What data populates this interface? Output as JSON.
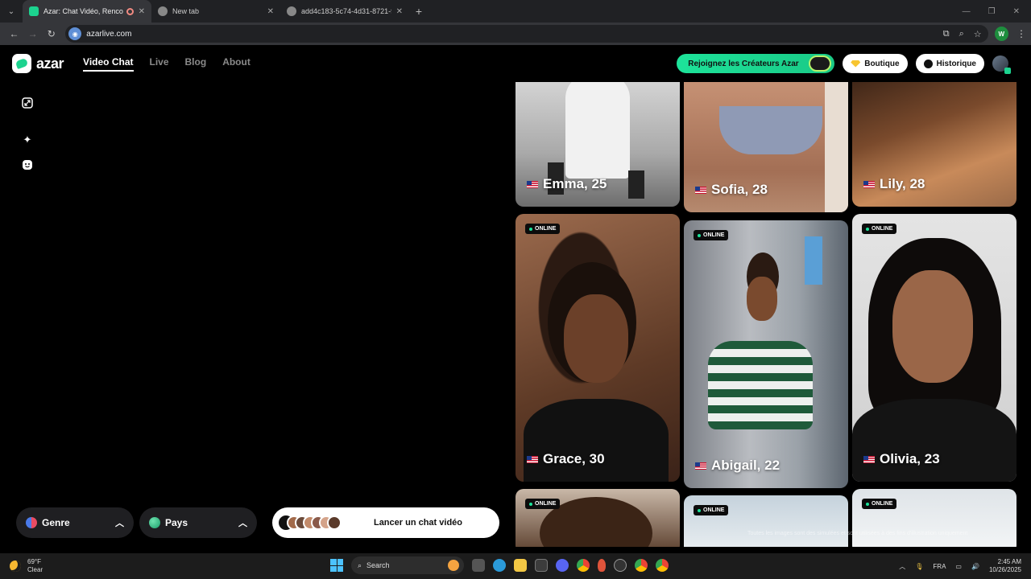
{
  "browser": {
    "tabs": [
      {
        "title": "Azar: Chat Vidéo, Rencontr",
        "active": true
      },
      {
        "title": "New tab",
        "active": false
      },
      {
        "title": "add4c183-5c74-4d31-8721-f2",
        "active": false
      }
    ],
    "url": "azarlive.com"
  },
  "header": {
    "brand": "azar",
    "nav": [
      "Video Chat",
      "Live",
      "Blog",
      "About"
    ],
    "creators_label": "Rejoignez les Créateurs Azar",
    "shop_label": "Boutique",
    "history_label": "Historique"
  },
  "controls": {
    "gender_label": "Genre",
    "country_label": "Pays",
    "start_label": "Lancer un chat vidéo"
  },
  "profiles": [
    {
      "name": "Emma, 25",
      "online": false
    },
    {
      "name": "Sofia, 28",
      "online": false
    },
    {
      "name": "Lily, 28",
      "online": false
    },
    {
      "name": "Grace, 30",
      "online": true
    },
    {
      "name": "Abigail, 22",
      "online": true
    },
    {
      "name": "Olivia, 23",
      "online": true
    }
  ],
  "online_label": "ONLINE",
  "disclaimer": "Toutes les images sont des simulées et sont utilisées à des fins d'illustration uniquement",
  "taskbar": {
    "temp": "69°F",
    "condition": "Clear",
    "search_placeholder": "Search",
    "lang": "FRA",
    "time": "2:45 AM",
    "date": "10/26/2025"
  }
}
